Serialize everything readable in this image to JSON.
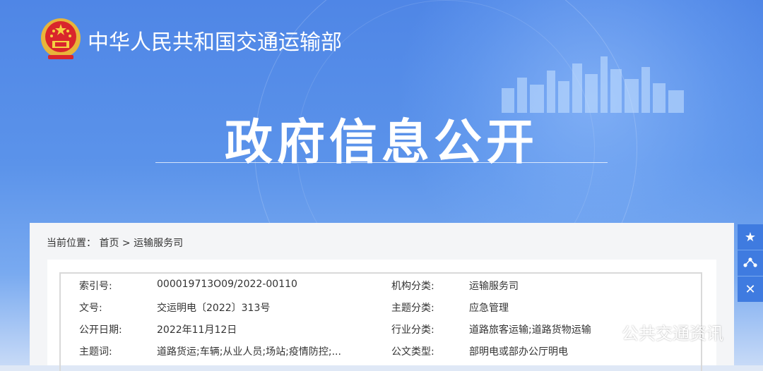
{
  "header": {
    "ministry_name": "中华人民共和国交通运输部",
    "page_title": "政府信息公开"
  },
  "breadcrumb": {
    "prefix": "当前位置：",
    "home": "首页",
    "separator": ">",
    "current": "运输服务司"
  },
  "info": {
    "rows": [
      {
        "label1": "索引号:",
        "value1": "000019713O09/2022-00110",
        "label2": "机构分类:",
        "value2": "运输服务司"
      },
      {
        "label1": "文号:",
        "value1": "交运明电〔2022〕313号",
        "label2": "主题分类:",
        "value2": "应急管理"
      },
      {
        "label1": "公开日期:",
        "value1": "2022年11月12日",
        "label2": "行业分类:",
        "value2": "道路旅客运输;道路货物运输"
      },
      {
        "label1": "主题词:",
        "value1": "道路货运;车辆;从业人员;场站;疫情防控;...",
        "label2": "公文类型:",
        "value2": "部明电或部办公厅明电"
      }
    ]
  },
  "side_tools": {
    "favorite_icon": "★",
    "share_icon": "share-icon",
    "close_icon": "✕"
  },
  "watermark": {
    "text": "公共交通资讯"
  }
}
